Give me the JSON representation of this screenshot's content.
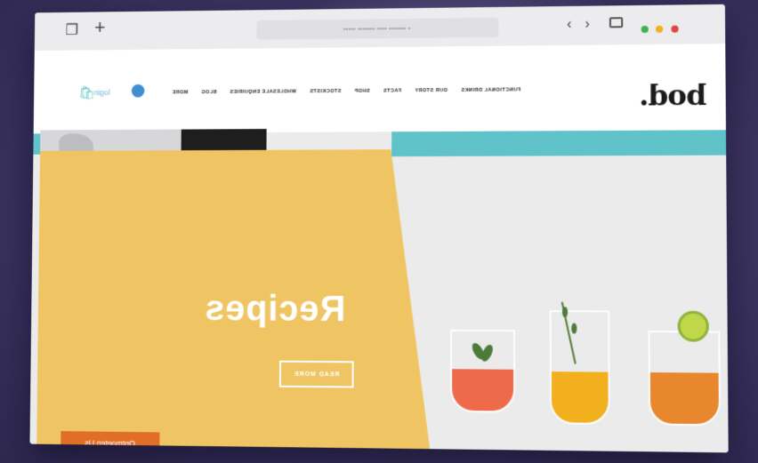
{
  "browser": {
    "tabs_icon": "tabs-icon",
    "new_tab_label": "+",
    "url_text": "• ••••••• •••• ••••••• •••••",
    "back_label": "‹",
    "forward_label": "›",
    "traffic_colors": [
      "#3bb54a",
      "#f2b01e",
      "#e2453c"
    ]
  },
  "nav": {
    "login_label": "login",
    "links": [
      "FUNCTIONAL DRINKS",
      "OUR STORY",
      "FACTS",
      "SHOP",
      "STOCKISTS",
      "WHOLESALE ENQUIRIES",
      "BLOG",
      "MORE"
    ],
    "logo_text": "bod."
  },
  "hero": {
    "title": "Recipes",
    "button_label": "READ MORE",
    "corner_button_label": "Ontmoeten Us"
  },
  "colors": {
    "accent_yellow": "#efc462",
    "accent_teal": "#5fc3c9",
    "cta_orange": "#e06e26"
  }
}
